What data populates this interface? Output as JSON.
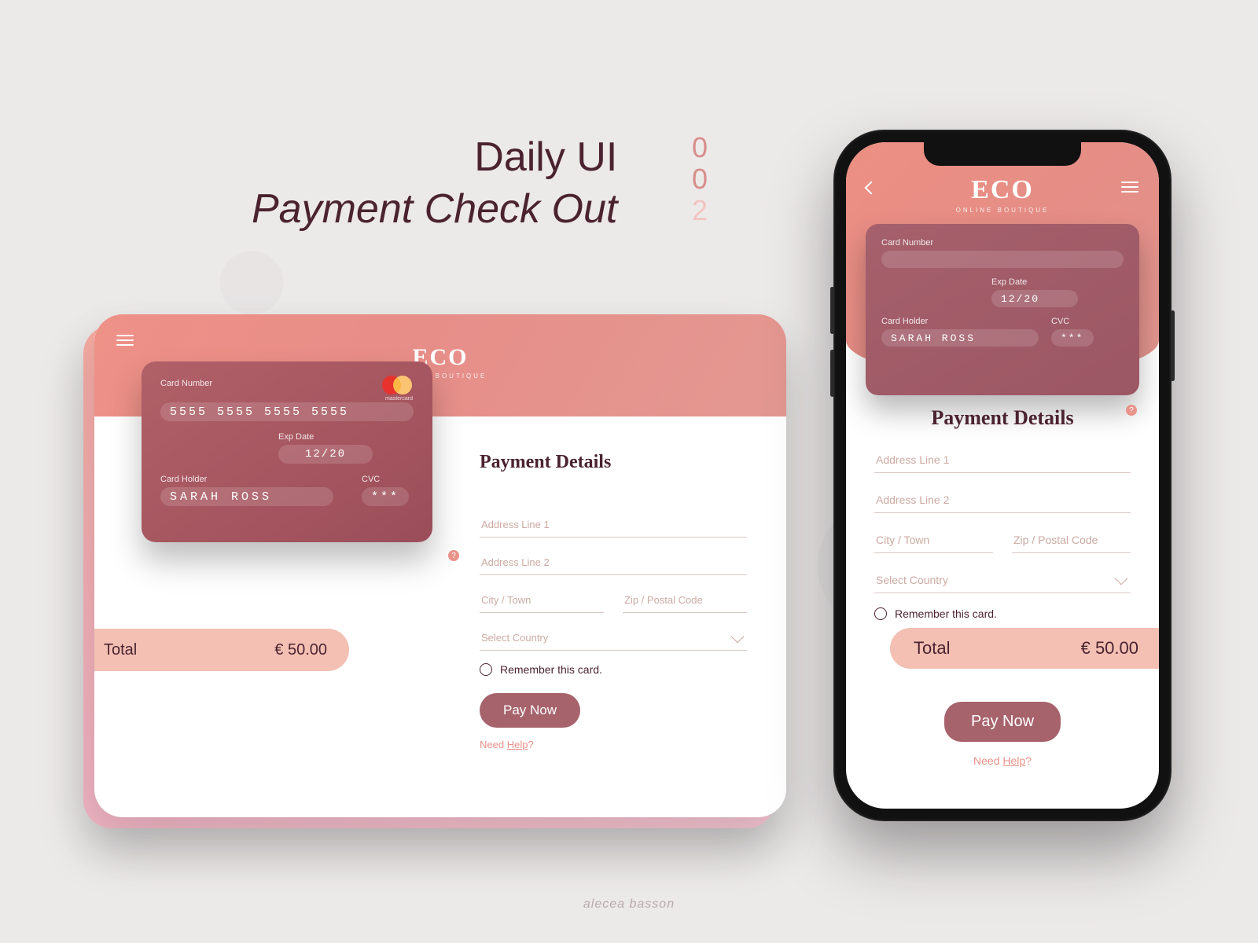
{
  "hero": {
    "line1": "Daily UI",
    "line2": "Payment Check Out",
    "digits": [
      "0",
      "0",
      "2"
    ]
  },
  "brand": {
    "name": "ECO",
    "sub": "ONLINE BOUTIQUE"
  },
  "card": {
    "number_label": "Card Number",
    "number": "5555 5555 5555 5555",
    "exp_label": "Exp Date",
    "exp": "12/20",
    "holder_label": "Card Holder",
    "holder": "SARAH ROSS",
    "cvc_label": "CVC",
    "cvc": "***",
    "network": "mastercard"
  },
  "form": {
    "title": "Payment Details",
    "addr1": "Address Line 1",
    "addr2": "Address Line 2",
    "city": "City / Town",
    "zip": "Zip / Postal Code",
    "country": "Select Country",
    "remember": "Remember this card.",
    "total_label": "Total",
    "total_value": "€ 50.00",
    "pay": "Pay Now",
    "help_pre": "Need ",
    "help_link": "Help",
    "help_post": "?"
  },
  "credit": "alecea basson",
  "icons": {
    "menu": "menu-icon",
    "back": "chevron-left-icon",
    "dropdown": "chevron-down-icon",
    "info": "question-icon"
  }
}
